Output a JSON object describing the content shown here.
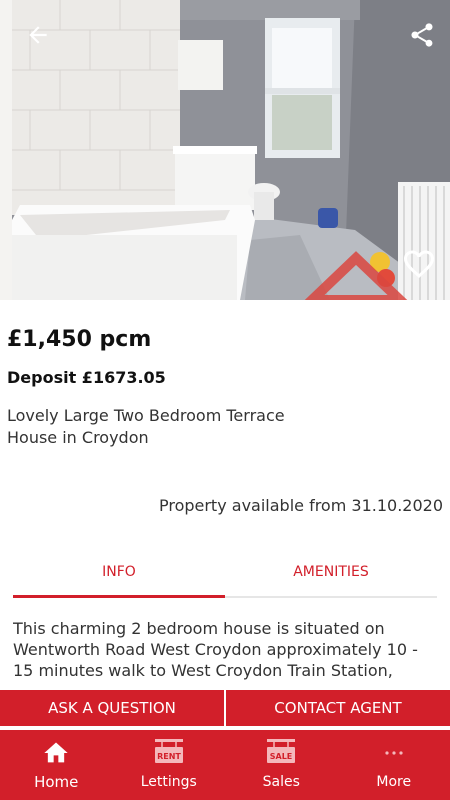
{
  "listing": {
    "price": "£1,450 pcm",
    "deposit": "Deposit £1673.05",
    "title": "Lovely Large Two Bedroom Terrace House in Croydon",
    "availability": "Property available from 31.10.2020",
    "description": "This charming 2 bedroom house is situated on Wentworth Road West Croydon approximately 10 - 15 minutes walk to West Croydon Train Station,"
  },
  "tabs": [
    {
      "label": "INFO",
      "active": true
    },
    {
      "label": "AMENITIES",
      "active": false
    }
  ],
  "actions": {
    "ask_question": "ASK A QUESTION",
    "contact_agent": "CONTACT AGENT"
  },
  "nav": [
    {
      "label": "Home",
      "icon": "home-icon",
      "active": true
    },
    {
      "label": "Lettings",
      "icon": "rent-sign-icon",
      "badge": "RENT"
    },
    {
      "label": "Sales",
      "icon": "sale-sign-icon",
      "badge": "SALE"
    },
    {
      "label": "More",
      "icon": "more-dots-icon"
    }
  ],
  "icons": {
    "back": "arrow-back-icon",
    "share": "share-icon",
    "favourite": "heart-outline-icon"
  },
  "colors": {
    "brand_red": "#d21f2a",
    "text_dark": "#111111",
    "text_body": "#333333"
  }
}
